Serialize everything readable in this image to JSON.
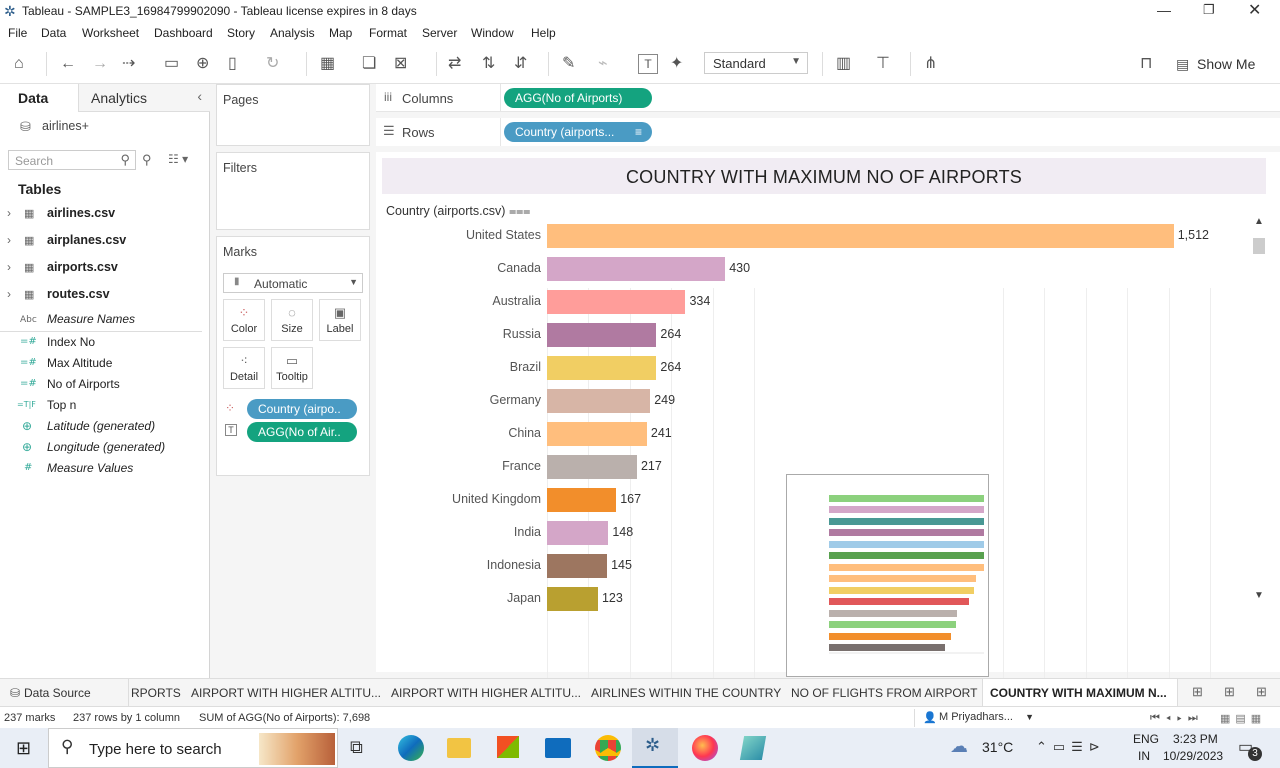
{
  "window": {
    "title": "Tableau - SAMPLE3_16984799902090 - Tableau license expires in 8 days"
  },
  "menu": [
    "File",
    "Data",
    "Worksheet",
    "Dashboard",
    "Story",
    "Analysis",
    "Map",
    "Format",
    "Server",
    "Window",
    "Help"
  ],
  "toolbar": {
    "fit_select": "Standard",
    "show_me": "Show Me"
  },
  "left": {
    "tab_data": "Data",
    "tab_analytics": "Analytics",
    "datasource": "airlines+",
    "search_placeholder": "Search",
    "tables_title": "Tables",
    "tables": [
      "airlines.csv",
      "airplanes.csv",
      "airports.csv",
      "routes.csv"
    ],
    "fields": [
      {
        "icon": "Abc",
        "name": "Measure Names",
        "italic": true
      },
      {
        "icon": "=#",
        "name": "Index No",
        "italic": false
      },
      {
        "icon": "=#",
        "name": "Max Altitude",
        "italic": false
      },
      {
        "icon": "=#",
        "name": "No of Airports",
        "italic": false
      },
      {
        "icon": "=T|F",
        "name": "Top n",
        "italic": false
      },
      {
        "icon": "⊕",
        "name": "Latitude (generated)",
        "italic": true
      },
      {
        "icon": "⊕",
        "name": "Longitude (generated)",
        "italic": true
      },
      {
        "icon": "#",
        "name": "Measure Values",
        "italic": true
      }
    ]
  },
  "shelves": {
    "pages": "Pages",
    "filters": "Filters",
    "marks": "Marks",
    "mark_type": "Automatic",
    "buttons": [
      "Color",
      "Size",
      "Label",
      "Detail",
      "Tooltip"
    ],
    "mark_pills": [
      "Country (airpo..",
      "AGG(No of Air.."
    ],
    "columns_label": "Columns",
    "rows_label": "Rows",
    "columns_pill": "AGG(No of Airports)",
    "rows_pill": "Country (airports..."
  },
  "sheet": {
    "title": "COUNTRY WITH MAXIMUM NO OF AIRPORTS",
    "row_header": "Country (airports.csv)"
  },
  "chart_data": {
    "type": "bar",
    "orientation": "horizontal",
    "categories": [
      "United States",
      "Canada",
      "Australia",
      "Russia",
      "Brazil",
      "Germany",
      "China",
      "France",
      "United Kingdom",
      "India",
      "Indonesia",
      "Japan"
    ],
    "values": [
      1512,
      430,
      334,
      264,
      264,
      249,
      241,
      217,
      167,
      148,
      145,
      123
    ],
    "value_labels": [
      "1,512",
      "430",
      "334",
      "264",
      "264",
      "249",
      "241",
      "217",
      "167",
      "148",
      "145",
      "123"
    ],
    "colors": [
      "#ffbe7d",
      "#d4a6c8",
      "#ff9d9a",
      "#b07aa1",
      "#f1ce63",
      "#d7b5a6",
      "#ffbe7d",
      "#bab0ac",
      "#f28e2b",
      "#d4a6c8",
      "#9d7660",
      "#b9a030"
    ],
    "x_ticks": [
      "0",
      "100",
      "200",
      "300",
      "400",
      "500",
      "1100",
      "1200",
      "1300",
      "1400",
      "1500",
      "1600"
    ],
    "xlim": [
      0,
      1650
    ]
  },
  "tabs": [
    "Data Source",
    "RPORTS",
    "AIRPORT WITH HIGHER ALTITU...",
    "AIRPORT WITH HIGHER ALTITU...",
    "AIRLINES WITHIN THE COUNTRY",
    "NO OF FLIGHTS FROM AIRPORT",
    "COUNTRY WITH MAXIMUM N..."
  ],
  "status": {
    "marks": "237 marks",
    "rows": "237 rows by 1 column",
    "sum": "SUM of AGG(No of Airports): 7,698",
    "user": "M Priyadhars..."
  },
  "taskbar": {
    "search": "Type here to search",
    "temp": "31°C",
    "lang1": "ENG",
    "lang2": "IN",
    "time": "3:23 PM",
    "date": "10/29/2023",
    "notif": "3"
  }
}
